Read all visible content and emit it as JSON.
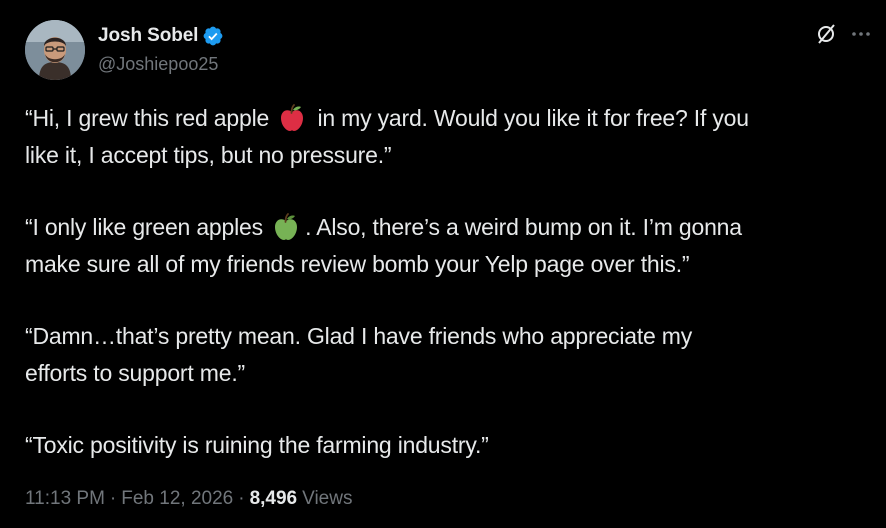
{
  "author": {
    "display_name": "Josh Sobel",
    "handle": "@Joshiepoo25",
    "verified": true
  },
  "colors": {
    "background": "#000000",
    "text": "#e7e9ea",
    "secondary": "#71767b",
    "verified_blue": "#1d9bf0"
  },
  "icons": {
    "grok": "grok-icon",
    "more": "more-icon",
    "verified": "verified-badge-icon"
  },
  "tweet": {
    "paragraphs": [
      {
        "line1_before_emoji": "“Hi, I grew this red apple ",
        "emoji": "red-apple-icon",
        "line1_after_emoji": " in my yard. Would you like it for free? If you",
        "line2": "like it, I accept tips, but no pressure.”"
      },
      {
        "line1_before_emoji": "“I only like green apples ",
        "emoji": "green-apple-icon",
        "line1_after_emoji": ". Also, there’s a  weird bump on it. I’m gonna",
        "line2": "make sure all of my friends review bomb your Yelp page over this.”"
      },
      {
        "line1": "“Damn…that’s pretty mean. Glad I have friends who appreciate my",
        "line2": "efforts to support me.”"
      },
      {
        "line1": "“Toxic positivity is ruining the farming industry.”"
      }
    ],
    "time": "11:13 PM",
    "separator": "·",
    "date": "Feb 12, 2026",
    "views_count": "8,496",
    "views_label": "Views"
  }
}
